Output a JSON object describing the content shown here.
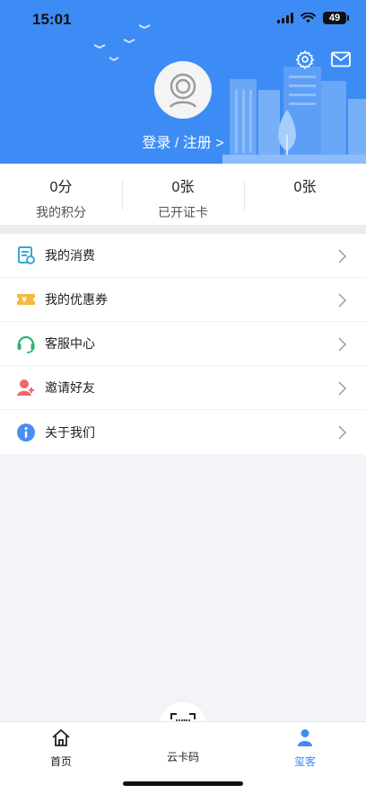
{
  "status": {
    "time": "15:01",
    "battery": "49"
  },
  "header": {
    "login_label": "登录 / 注册 >",
    "icons": [
      "gear-icon",
      "mail-icon",
      "avatar-placeholder-icon"
    ],
    "accent_color": "#3d8cf5"
  },
  "stats": [
    {
      "value": "0分",
      "label": "我的积分"
    },
    {
      "value": "0张",
      "label": "已开证卡"
    },
    {
      "value": "0张",
      "label": ""
    }
  ],
  "menu": [
    {
      "label": "我的消费",
      "icon": "receipt-icon"
    },
    {
      "label": "我的优惠券",
      "icon": "coupon-icon"
    },
    {
      "label": "客服中心",
      "icon": "headset-icon"
    },
    {
      "label": "邀请好友",
      "icon": "invite-user-icon"
    },
    {
      "label": "关于我们",
      "icon": "info-icon"
    }
  ],
  "tabbar": {
    "items": [
      {
        "label": "首页",
        "icon": "home-icon"
      },
      {
        "label": "云卡码",
        "icon": "barcode-scan-icon"
      },
      {
        "label": "玺客",
        "icon": "person-icon"
      }
    ],
    "active": "玺客"
  }
}
